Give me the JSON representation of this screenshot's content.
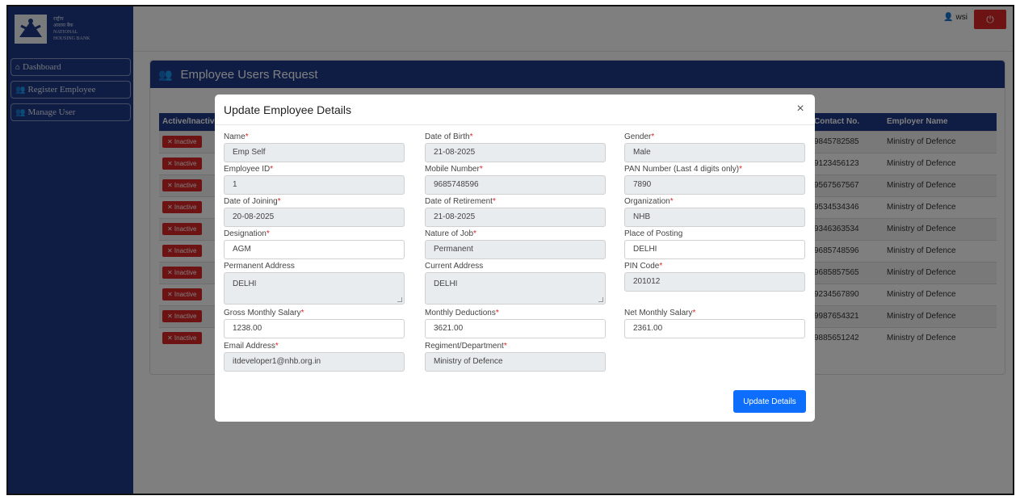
{
  "logo": {
    "lines": [
      "राष्ट्रीय",
      "आवास बैंक",
      "NATIONAL",
      "HOUSING BANK"
    ]
  },
  "sidebar": {
    "items": [
      {
        "label": "Dashboard",
        "icon": "home-icon"
      },
      {
        "label": "Register Employee",
        "icon": "users-icon"
      },
      {
        "label": "Manage User",
        "icon": "users-icon"
      }
    ]
  },
  "topbar": {
    "user_label": "wsi",
    "power_icon": "power-icon"
  },
  "card": {
    "title": "Employee Users Request",
    "columns": [
      "Active/Inactive",
      "Contact No.",
      "Employer Name"
    ],
    "rows": [
      {
        "status": "✕ Inactive",
        "contact": "9845782585",
        "employer": "Ministry of Defence"
      },
      {
        "status": "✕ Inactive",
        "contact": "9123456123",
        "employer": "Ministry of Defence"
      },
      {
        "status": "✕ Inactive",
        "contact": "9567567567",
        "employer": "Ministry of Defence"
      },
      {
        "status": "✕ Inactive",
        "contact": "9534534346",
        "employer": "Ministry of Defence"
      },
      {
        "status": "✕ Inactive",
        "contact": "9346363534",
        "employer": "Ministry of Defence"
      },
      {
        "status": "✕ Inactive",
        "contact": "9685748596",
        "employer": "Ministry of Defence"
      },
      {
        "status": "✕ Inactive",
        "contact": "9685857565",
        "employer": "Ministry of Defence"
      },
      {
        "status": "✕ Inactive",
        "contact": "9234567890",
        "employer": "Ministry of Defence"
      },
      {
        "status": "✕ Inactive",
        "contact": "9987654321",
        "employer": "Ministry of Defence"
      },
      {
        "status": "✕ Inactive",
        "contact": "9885651242",
        "employer": "Ministry of Defence"
      }
    ]
  },
  "modal": {
    "title": "Update Employee Details",
    "close_label": "×",
    "submit_label": "Update Details",
    "fields": {
      "name": {
        "label": "Name",
        "value": "Emp Self"
      },
      "dob": {
        "label": "Date of Birth",
        "value": "21-08-2025"
      },
      "gender": {
        "label": "Gender",
        "value": "Male"
      },
      "employee_id": {
        "label": "Employee ID",
        "value": "1"
      },
      "mobile": {
        "label": "Mobile Number",
        "value": "9685748596"
      },
      "pan": {
        "label": "PAN Number (Last 4 digits only)",
        "value": "7890"
      },
      "doj": {
        "label": "Date of Joining",
        "value": "20-08-2025"
      },
      "dor": {
        "label": "Date of Retirement",
        "value": "21-08-2025"
      },
      "organization": {
        "label": "Organization",
        "value": "NHB"
      },
      "designation": {
        "label": "Designation",
        "value": "AGM"
      },
      "nature_of_job": {
        "label": "Nature of Job",
        "value": "Permanent"
      },
      "place_of_posting": {
        "label": "Place of Posting",
        "value": "DELHI"
      },
      "permanent_address": {
        "label": "Permanent Address",
        "value": "DELHI"
      },
      "current_address": {
        "label": "Current Address",
        "value": "DELHI"
      },
      "pin_code": {
        "label": "PIN Code",
        "value": "201012"
      },
      "gross_salary": {
        "label": "Gross Monthly Salary",
        "value": "1238.00"
      },
      "deductions": {
        "label": "Monthly Deductions",
        "value": "3621.00"
      },
      "net_salary": {
        "label": "Net Monthly Salary",
        "value": "2361.00"
      },
      "email": {
        "label": "Email Address",
        "value": "itdeveloper1@nhb.org.in"
      },
      "regiment": {
        "label": "Regiment/Department",
        "value": "Ministry of Defence"
      }
    }
  },
  "colors": {
    "navy": "#1e3a8a",
    "danger": "#dc2626",
    "primary": "#0d6efd"
  }
}
